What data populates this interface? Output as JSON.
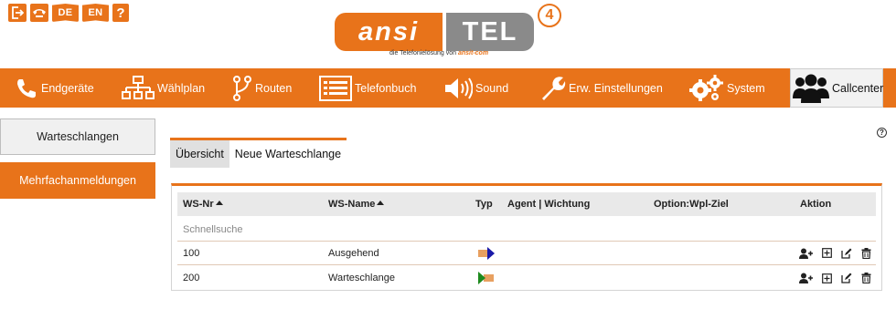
{
  "top_icons": {
    "lang_de": "DE",
    "lang_en": "EN",
    "help": "?"
  },
  "logo": {
    "left_text": "ansi",
    "right_text": "TEL",
    "version": "4",
    "tagline": "die Telefonielösung von",
    "tagline_brand": "ansit-com"
  },
  "nav": {
    "items": [
      {
        "label": "Endgeräte",
        "icon": "phone-icon"
      },
      {
        "label": "Wählplan",
        "icon": "sitemap-icon"
      },
      {
        "label": "Routen",
        "icon": "route-icon"
      },
      {
        "label": "Telefonbuch",
        "icon": "list-icon"
      },
      {
        "label": "Sound",
        "icon": "speaker-icon"
      },
      {
        "label": "Erw. Einstellungen",
        "icon": "wrench-icon"
      },
      {
        "label": "System",
        "icon": "gears-icon"
      },
      {
        "label": "Callcenter",
        "icon": "users-icon"
      }
    ],
    "active": "Callcenter"
  },
  "sidebar": {
    "items": [
      {
        "label": "Warteschlangen"
      },
      {
        "label": "Mehrfachanmeldungen"
      }
    ]
  },
  "help_label": "?",
  "tabs": [
    {
      "label": "Übersicht"
    },
    {
      "label": "Neue Warteschlange"
    }
  ],
  "table": {
    "columns": [
      "WS-Nr",
      "WS-Name",
      "Typ",
      "Agent | Wichtung",
      "Option:Wpl-Ziel",
      "Aktion"
    ],
    "search_label": "Schnellsuche",
    "rows": [
      {
        "nr": "100",
        "name": "Ausgehend",
        "typ": "outgoing"
      },
      {
        "nr": "200",
        "name": "Warteschlange",
        "typ": "incoming"
      }
    ]
  },
  "colors": {
    "accent": "#e8731a",
    "logo_gray": "#8a8a8a",
    "arrow_blue": "#1a1aa8",
    "arrow_green": "#1e8a1e"
  }
}
